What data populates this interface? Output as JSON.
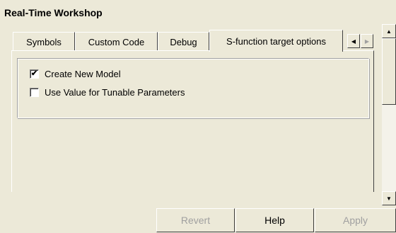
{
  "panel_title": "Real-Time Workshop",
  "tabs": [
    {
      "label": "Symbols"
    },
    {
      "label": "Custom Code"
    },
    {
      "label": "Debug"
    },
    {
      "label": "S-function target options",
      "active": true
    }
  ],
  "tab_scroll": {
    "left_icon": "triangle-left-icon",
    "right_icon": "triangle-right-icon",
    "left_glyph": "◀",
    "right_glyph": "▶"
  },
  "options": [
    {
      "label": "Create New Model",
      "checked": true
    },
    {
      "label": "Use Value for Tunable Parameters",
      "checked": false
    }
  ],
  "scrollbar": {
    "up_glyph": "▲",
    "down_glyph": "▼"
  },
  "buttons": {
    "revert": "Revert",
    "help": "Help",
    "apply": "Apply"
  },
  "check_glyph": "✔"
}
